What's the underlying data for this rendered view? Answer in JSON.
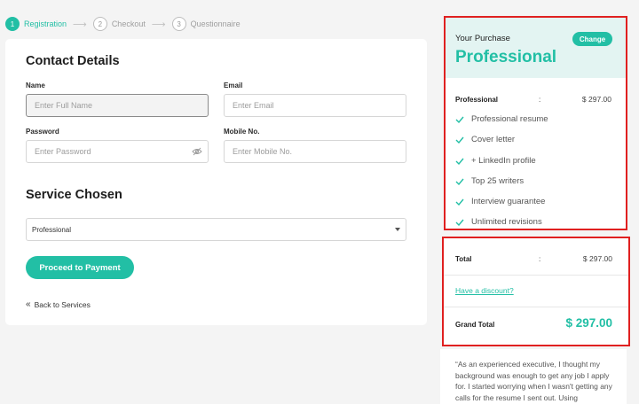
{
  "stepper": [
    {
      "num": "1",
      "label": "Registration"
    },
    {
      "num": "2",
      "label": "Checkout"
    },
    {
      "num": "3",
      "label": "Questionnaire"
    }
  ],
  "contact": {
    "title": "Contact Details",
    "name_label": "Name",
    "name_placeholder": "Enter Full Name",
    "email_label": "Email",
    "email_placeholder": "Enter Email",
    "password_label": "Password",
    "password_placeholder": "Enter Password",
    "mobile_label": "Mobile No.",
    "mobile_placeholder": "Enter Mobile No."
  },
  "service": {
    "title": "Service Chosen",
    "selected": "Professional",
    "proceed_label": "Proceed to Payment",
    "back_label": "Back to Services"
  },
  "purchase": {
    "caption": "Your Purchase",
    "plan": "Professional",
    "change_label": "Change",
    "line_label": "Professional",
    "line_sep": ":",
    "line_value": "$ 297.00",
    "features": [
      "Professional resume",
      "Cover letter",
      "+ LinkedIn profile",
      "Top 25 writers",
      "Interview guarantee",
      "Unlimited revisions"
    ]
  },
  "totals": {
    "total_label": "Total",
    "total_sep": ":",
    "total_value": "$ 297.00",
    "discount_label": "Have a discount?",
    "grand_label": "Grand Total",
    "grand_value": "$ 297.00"
  },
  "testimonial": {
    "text": "“As an experienced executive, I thought my background was enough to get any job I apply for. I started worrying when I wasn't getting any calls for the resume I sent out. Using"
  },
  "colors": {
    "accent": "#22bfa5",
    "highlight_border": "#e02020",
    "head_bg": "#e3f4f2"
  }
}
